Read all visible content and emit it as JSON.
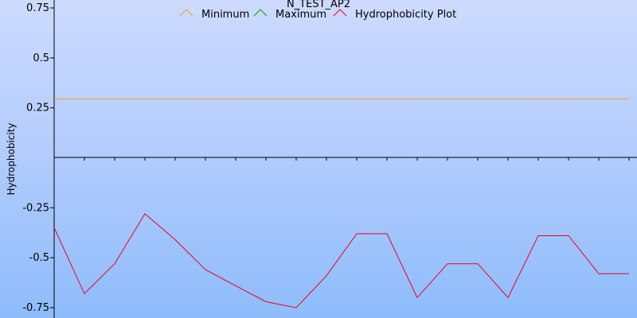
{
  "chart_data": {
    "type": "line",
    "title": "N_TEST_AP2",
    "xlabel": "",
    "ylabel": "Hydrophobicity",
    "ylim": [
      -0.75,
      0.75
    ],
    "yticks": [
      {
        "value": 0.75,
        "label": "0.75"
      },
      {
        "value": 0.5,
        "label": "0.5"
      },
      {
        "value": 0.25,
        "label": "0.25"
      },
      {
        "value": -0.25,
        "label": "-0.25"
      },
      {
        "value": -0.5,
        "label": "-0.5"
      },
      {
        "value": -0.75,
        "label": "-0.75"
      }
    ],
    "xlim": [
      0,
      19
    ],
    "x": [
      0,
      1,
      2,
      3,
      4,
      5,
      6,
      7,
      8,
      9,
      10,
      11,
      12,
      13,
      14,
      15,
      16,
      17,
      18,
      19
    ],
    "grid": false,
    "legend_position": "top",
    "series": [
      {
        "name": "Minimum",
        "color": "#f0a030",
        "values": [
          0.295,
          0.295,
          0.295,
          0.295,
          0.295,
          0.295,
          0.295,
          0.295,
          0.295,
          0.295,
          0.295,
          0.295,
          0.295,
          0.295,
          0.295,
          0.295,
          0.295,
          0.295,
          0.295,
          0.295
        ]
      },
      {
        "name": "Maximum",
        "color": "#00a000",
        "values": []
      },
      {
        "name": "Hydrophobicity Plot",
        "color": "#e8002a",
        "values": [
          -0.35,
          -0.68,
          -0.53,
          -0.28,
          -0.41,
          -0.56,
          -0.64,
          -0.72,
          -0.75,
          -0.59,
          -0.38,
          -0.38,
          -0.7,
          -0.53,
          -0.53,
          -0.7,
          -0.39,
          -0.39,
          -0.58,
          -0.58
        ]
      }
    ]
  }
}
